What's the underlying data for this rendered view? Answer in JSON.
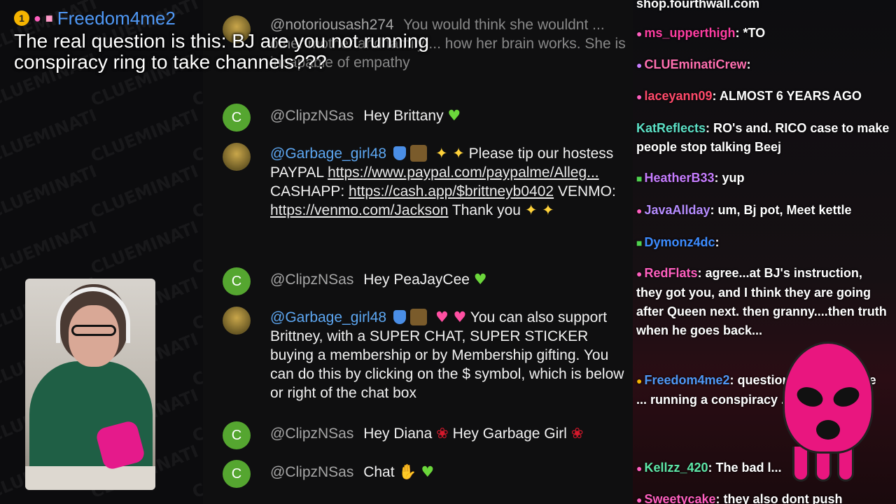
{
  "highlight": {
    "badge": "1",
    "name": "Freedom4me2",
    "message": "The real question is this: BJ are you not running conspiracy ring to take channels???"
  },
  "midchat": {
    "top_partial": {
      "author": "@notoriousash274",
      "text": "You would think she wouldnt ... other mother and family ... how her brain works. She is incapable of empathy"
    },
    "messages": [
      {
        "author": "@ClipzNSas",
        "text": "Hey Brittany"
      },
      {
        "author": "@Garbage_girl48",
        "pre": "Please tip our hostess PAYPAL",
        "link1": "https://www.paypal.com/paypalme/Alleg...",
        "mid1": "CASHAPP:",
        "link2": "https://cash.app/$brittneyb0402",
        "mid2": "VENMO:",
        "link3": "https://venmo.com/Jackson",
        "post": "Thank you"
      },
      {
        "author": "@ClipzNSas",
        "text": "Hey PeaJayCee"
      },
      {
        "author": "@Garbage_girl48",
        "text": "You can also support Brittney, with a SUPER CHAT, SUPER STICKER buying a membership or by Membership gifting. You can do this by clicking on the $ symbol, which is below or right of the chat box"
      },
      {
        "author": "@ClipzNSas",
        "text": "Hey Diana",
        "text2": "Hey Garbage Girl"
      },
      {
        "author": "@ClipzNSas",
        "text": "Chat"
      }
    ]
  },
  "rightchat": {
    "top_text": "shop.fourthwall.com",
    "lines": [
      {
        "name": "ms_upperthigh",
        "color": "#ff3da2",
        "text": "*TO"
      },
      {
        "name": "CLUEminatiCrew",
        "color": "#ff6fb0",
        "text": ""
      },
      {
        "name": "laceyann09",
        "color": "#ff4a6a",
        "text": "ALMOST 6 YEARS AGO"
      },
      {
        "name": "KatReflects",
        "color": "#5ce0c6",
        "text": "RO's and. RICO case to make people stop talking Beej"
      },
      {
        "name": "HeatherB33",
        "color": "#c77dff",
        "text": "yup"
      },
      {
        "name": "JavaAllday",
        "color": "#b68cff",
        "text": "um, Bj pot, Meet kettle"
      },
      {
        "name": "Dymonz4dc",
        "color": "#3d8cff",
        "text": ""
      },
      {
        "name": "RedFlats",
        "color": "#ff5fbf",
        "text": "agree...at BJ's instruction, they got you, and I think they are going after Queen next. then granny....then truth when he goes back..."
      },
      {
        "name": "Freedom4me2",
        "color": "#4f98f5",
        "text": "question is this: BJ are ... running a conspiracy ... channels???"
      },
      {
        "name": "Kellzz_420",
        "color": "#5ee8a8",
        "text": "The bad l..."
      },
      {
        "name": "Sweetycake",
        "color": "#ff5fbf",
        "text": "they also dont push"
      }
    ]
  },
  "watermark": "CLUEMINATI"
}
